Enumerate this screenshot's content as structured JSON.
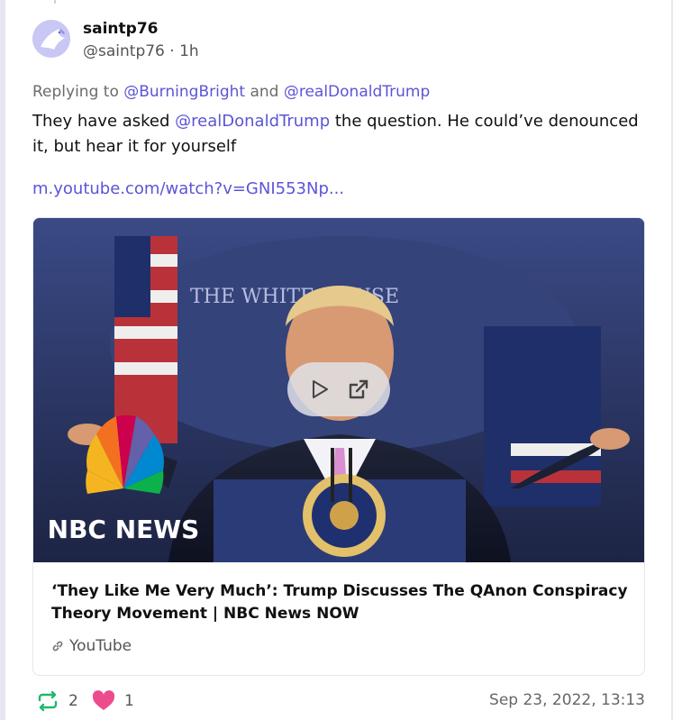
{
  "post": {
    "display_name": "saintp76",
    "handle": "@saintp76",
    "age": "1h",
    "replying_prefix": "Replying to",
    "reply_targets": [
      "@BurningBright",
      "@realDonaldTrump"
    ],
    "reply_joiner": "and",
    "body_before_mention": "They have asked ",
    "body_mention": "@realDonaldTrump",
    "body_after_mention": " the question. He could’ve denounced it, but hear it for yourself",
    "link": "m.youtube.com/watch?v=GNI553Np...",
    "card": {
      "title": "‘They Like Me Very Much’: Trump Discusses The QAnon Conspiracy Theory Movement | NBC News NOW",
      "source": "YouTube",
      "thumbnail_label_1": "THE WHITE HOUSE",
      "thumbnail_logo_text": "NBC NEWS"
    },
    "reposts": "2",
    "likes": "1",
    "timestamp": "Sep 23, 2022, 13:13"
  },
  "colors": {
    "mention": "#5b55d6",
    "like": "#ec4c8d",
    "repost": "#20b86b",
    "avatar": "#c9c7f3"
  },
  "icons": {
    "avatar": "eagle-avatar-icon",
    "play": "play-icon",
    "open": "open-external-icon",
    "link": "link-icon",
    "repost": "repost-icon",
    "like": "heart-icon"
  }
}
